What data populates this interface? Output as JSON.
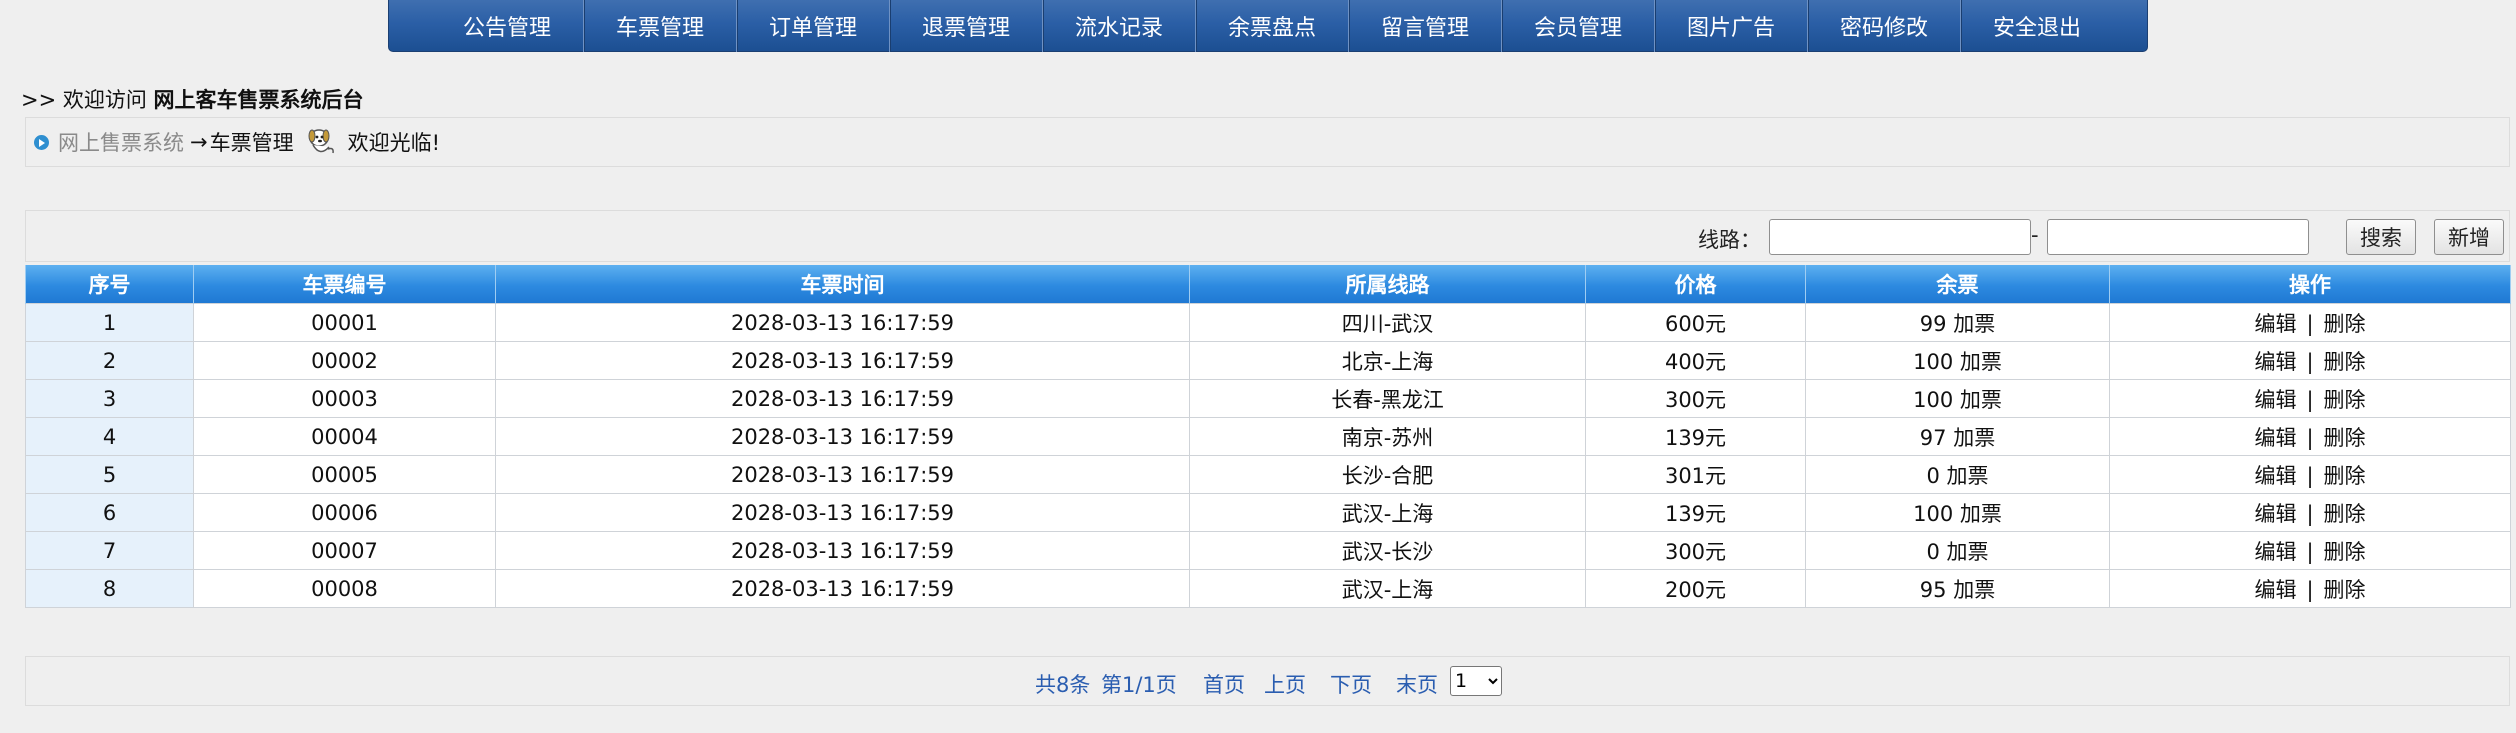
{
  "nav": [
    "公告管理",
    "车票管理",
    "订单管理",
    "退票管理",
    "流水记录",
    "余票盘点",
    "留言管理",
    "会员管理",
    "图片广告",
    "密码修改",
    "安全退出"
  ],
  "welcome": {
    "prefix": ">> 欢迎访问 ",
    "title": "网上客车售票系统后台"
  },
  "breadcrumb": {
    "system": "网上售票系统",
    "arrow": "→",
    "current": "车票管理",
    "greeting": "欢迎光临!"
  },
  "search": {
    "label": "线路：",
    "dash": "-",
    "from_value": "",
    "to_value": "",
    "search_button": "搜索",
    "add_button": "新增"
  },
  "table": {
    "headers": [
      "序号",
      "车票编号",
      "车票时间",
      "所属线路",
      "价格",
      "余票",
      "操作"
    ],
    "rows": [
      {
        "no": "1",
        "code": "00001",
        "time": "2028-03-13 16:17:59",
        "route": "四川-武汉",
        "price": "600元",
        "remain": "99 加票"
      },
      {
        "no": "2",
        "code": "00002",
        "time": "2028-03-13 16:17:59",
        "route": "北京-上海",
        "price": "400元",
        "remain": "100 加票"
      },
      {
        "no": "3",
        "code": "00003",
        "time": "2028-03-13 16:17:59",
        "route": "长春-黑龙江",
        "price": "300元",
        "remain": "100 加票"
      },
      {
        "no": "4",
        "code": "00004",
        "time": "2028-03-13 16:17:59",
        "route": "南京-苏州",
        "price": "139元",
        "remain": "97 加票"
      },
      {
        "no": "5",
        "code": "00005",
        "time": "2028-03-13 16:17:59",
        "route": "长沙-合肥",
        "price": "301元",
        "remain": "0 加票"
      },
      {
        "no": "6",
        "code": "00006",
        "time": "2028-03-13 16:17:59",
        "route": "武汉-上海",
        "price": "139元",
        "remain": "100 加票"
      },
      {
        "no": "7",
        "code": "00007",
        "time": "2028-03-13 16:17:59",
        "route": "武汉-长沙",
        "price": "300元",
        "remain": "0 加票"
      },
      {
        "no": "8",
        "code": "00008",
        "time": "2028-03-13 16:17:59",
        "route": "武汉-上海",
        "price": "200元",
        "remain": "95 加票"
      }
    ],
    "edit_label": "编辑",
    "sep": "|",
    "delete_label": "删除"
  },
  "pager": {
    "total": "共8条",
    "page": "第1/1页",
    "first": "首页",
    "prev": "上页",
    "next": "下页",
    "last": "末页",
    "selected": "1"
  }
}
